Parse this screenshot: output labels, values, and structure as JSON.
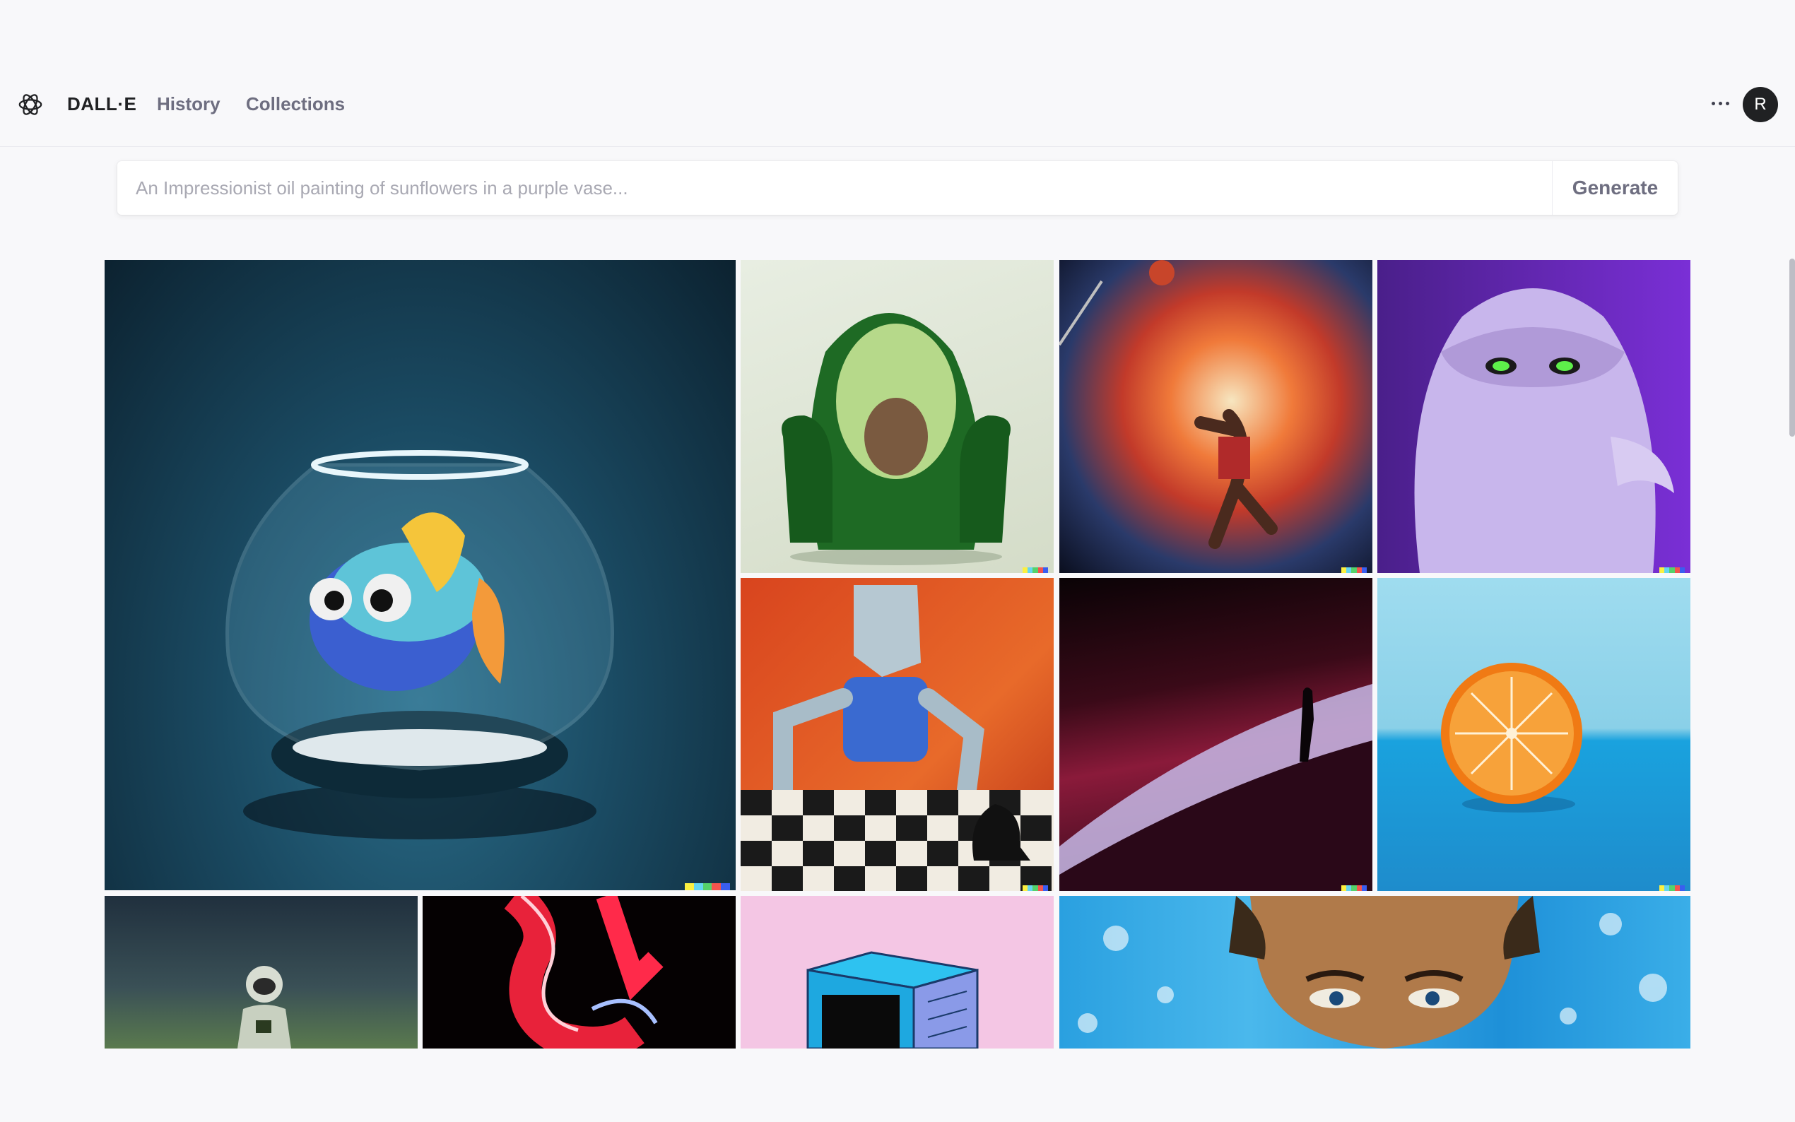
{
  "app": {
    "brand": "DALL·E",
    "nav": [
      {
        "label": "History"
      },
      {
        "label": "Collections"
      }
    ],
    "avatar_initial": "R"
  },
  "prompt": {
    "placeholder": "An Impressionist oil painting of sunflowers in a purple vase...",
    "value": "",
    "generate_label": "Generate"
  },
  "gallery": [
    {
      "subject": "goldfish-bowl"
    },
    {
      "subject": "avocado-armchair"
    },
    {
      "subject": "cosmic-basketball-dunk"
    },
    {
      "subject": "purple-furry-monster"
    },
    {
      "subject": "robot-playing-chess"
    },
    {
      "subject": "figure-in-desert-dunes"
    },
    {
      "subject": "half-orange"
    },
    {
      "subject": "astronaut"
    },
    {
      "subject": "neon-shape"
    },
    {
      "subject": "blue-box-on-pink"
    },
    {
      "subject": "painted-face"
    }
  ],
  "colors": {
    "accent": "#202123",
    "muted": "#6e6e80",
    "background": "#f8f8fa",
    "signature": [
      "#fcf040",
      "#64d6f0",
      "#55d26a",
      "#f3544e",
      "#3a5ef0"
    ]
  }
}
